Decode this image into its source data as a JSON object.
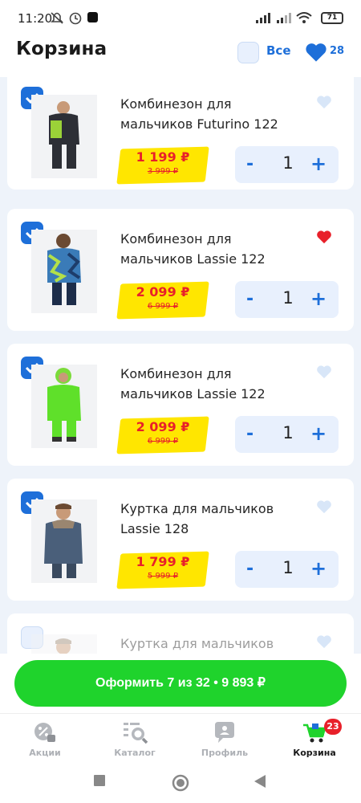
{
  "status": {
    "time": "11:20",
    "battery": "71"
  },
  "header": {
    "title": "Корзина",
    "select_all_label": "Все",
    "favorites_count": "28"
  },
  "items": [
    {
      "name": "Комбинезон для мальчиков Futurino 122",
      "price": "1 199 ₽",
      "old_price": "3 999 ₽",
      "qty": "1",
      "checked": true,
      "favorite": false
    },
    {
      "name": "Комбинезон для мальчиков Lassie 122",
      "price": "2 099 ₽",
      "old_price": "6 999 ₽",
      "qty": "1",
      "checked": true,
      "favorite": true
    },
    {
      "name": "Комбинезон для мальчиков Lassie 122",
      "price": "2 099 ₽",
      "old_price": "6 999 ₽",
      "qty": "1",
      "checked": true,
      "favorite": false
    },
    {
      "name": "Куртка для мальчиков Lassie 128",
      "price": "1 799 ₽",
      "old_price": "5 999 ₽",
      "qty": "1",
      "checked": true,
      "favorite": false
    },
    {
      "name": "Куртка для мальчиков",
      "checked": false,
      "favorite": false
    }
  ],
  "stepper": {
    "minus": "-",
    "plus": "+"
  },
  "checkout": {
    "label": "Оформить 7 из 32 • 9 893 ₽"
  },
  "nav": [
    {
      "label": "Акции",
      "icon": "promo-icon"
    },
    {
      "label": "Каталог",
      "icon": "catalog-search-icon"
    },
    {
      "label": "Профиль",
      "icon": "profile-icon"
    },
    {
      "label": "Корзина",
      "icon": "cart-icon",
      "badge": "23",
      "active": true
    }
  ],
  "colors": {
    "accent": "#1e6fd9",
    "price": "#e8202a",
    "price_tag": "#ffe600",
    "checkout": "#1fd32c",
    "fav_active": "#e8202a"
  }
}
